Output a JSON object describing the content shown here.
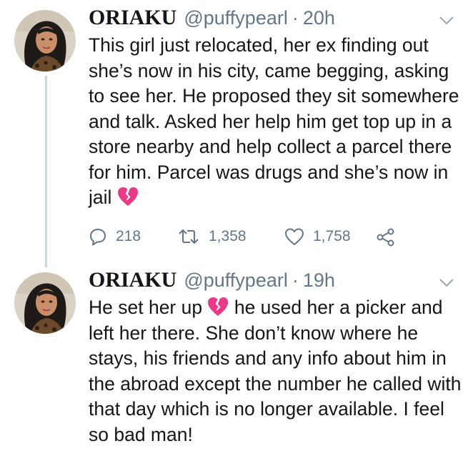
{
  "tweets": [
    {
      "display_name": "ORIAKU",
      "handle": "@puffypearl",
      "separator": "·",
      "time": "20h",
      "text_before_emoji": "This girl just relocated, her ex finding out she’s now in his city, came begging, asking to see her. He proposed they sit somewhere and talk. Asked her help him get top up in a store nearby and help collect a parcel there for him. Parcel was drugs and she’s now in jail",
      "text_after_emoji": "",
      "emoji": "broken-heart",
      "replies": "218",
      "retweets": "1,358",
      "likes": "1,758"
    },
    {
      "display_name": "ORIAKU",
      "handle": "@puffypearl",
      "separator": "·",
      "time": "19h",
      "text_before_emoji": "He set her up",
      "text_after_emoji": " he used her a picker and left her there. She don’t know where he stays, his friends and any info about him in the abroad except the  number he called with that day which is no longer available. I feel so bad man!",
      "emoji": "broken-heart"
    }
  ],
  "icons": {
    "reply": "reply-icon",
    "retweet": "retweet-icon",
    "like": "heart-icon",
    "share": "share-icon",
    "caret": "chevron-down-icon"
  },
  "colors": {
    "text": "#14171a",
    "secondary": "#657786",
    "thread_line": "#ccd6dd",
    "broken_heart": "#e83a87"
  }
}
